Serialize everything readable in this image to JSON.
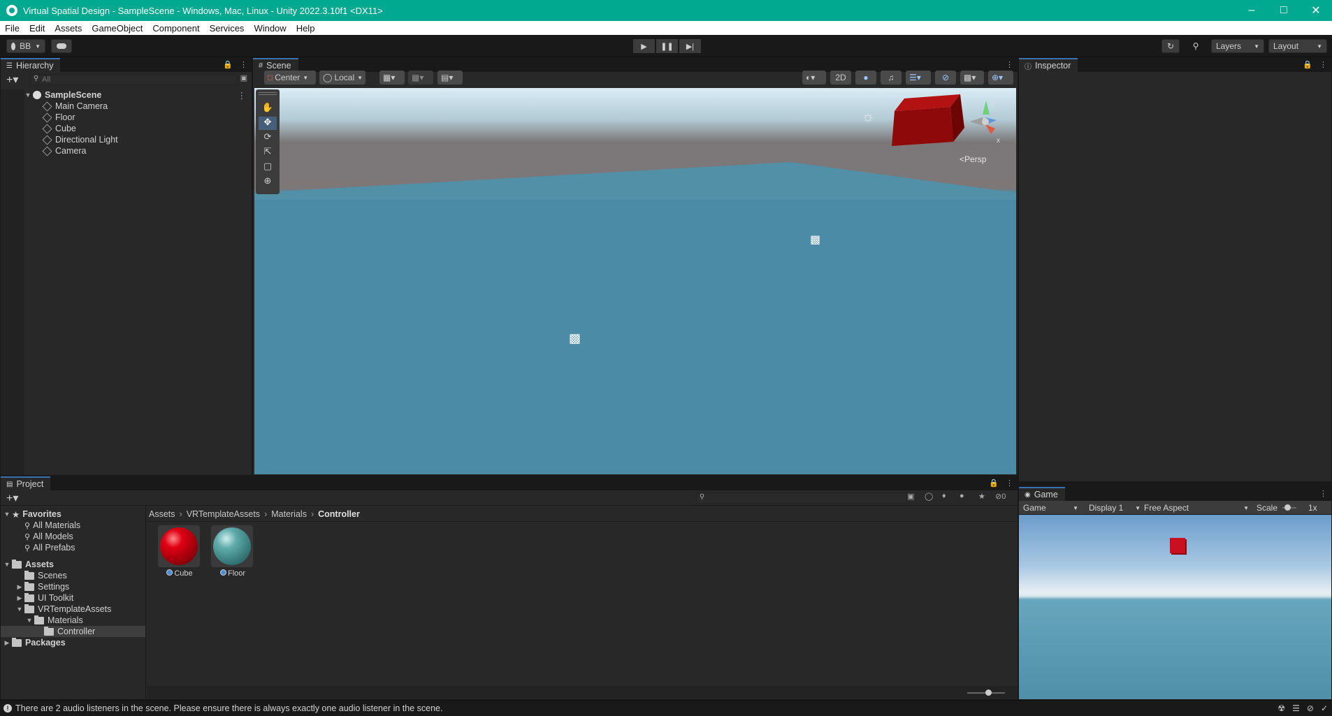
{
  "window": {
    "title": "Virtual Spatial Design - SampleScene - Windows, Mac, Linux - Unity 2022.3.10f1 <DX11>",
    "controls": [
      "minimize-icon",
      "maximize-icon",
      "close-icon"
    ]
  },
  "menu": [
    "File",
    "Edit",
    "Assets",
    "GameObject",
    "Component",
    "Services",
    "Window",
    "Help"
  ],
  "toolbar": {
    "account": "BB",
    "layers": "Layers",
    "layout": "Layout"
  },
  "hierarchy": {
    "tab": "Hierarchy",
    "search_placeholder": "All",
    "scene": "SampleScene",
    "items": [
      "Main Camera",
      "Floor",
      "Cube",
      "Directional Light",
      "Camera"
    ]
  },
  "scene": {
    "tab": "Scene",
    "pivot": "Center",
    "space": "Local",
    "mode_2d": "2D",
    "persp": "Persp",
    "gizmo_axes": [
      "y",
      "x"
    ]
  },
  "inspector": {
    "tab": "Inspector"
  },
  "project": {
    "tab": "Project",
    "hidden_count": "0",
    "favorites_label": "Favorites",
    "favorites": [
      "All Materials",
      "All Models",
      "All Prefabs"
    ],
    "assets_label": "Assets",
    "tree": [
      {
        "label": "Scenes",
        "arrow": ""
      },
      {
        "label": "Settings",
        "arrow": "▶"
      },
      {
        "label": "UI Toolkit",
        "arrow": "▶"
      },
      {
        "label": "VRTemplateAssets",
        "arrow": "▼"
      },
      {
        "label": "Materials",
        "arrow": "▼"
      },
      {
        "label": "Controller",
        "arrow": ""
      }
    ],
    "packages_label": "Packages",
    "breadcrumb": [
      "Assets",
      "VRTemplateAssets",
      "Materials",
      "Controller"
    ],
    "files": [
      {
        "name": "Cube",
        "color": "#c00010"
      },
      {
        "name": "Floor",
        "color": "#4e9a9a"
      }
    ]
  },
  "game": {
    "tab": "Game",
    "view": "Game",
    "display": "Display 1",
    "aspect": "Free Aspect",
    "scale_label": "Scale",
    "scale_value": "1x"
  },
  "status": {
    "message": "There are 2 audio listeners in the scene. Please ensure there is always exactly one audio listener in the scene."
  }
}
